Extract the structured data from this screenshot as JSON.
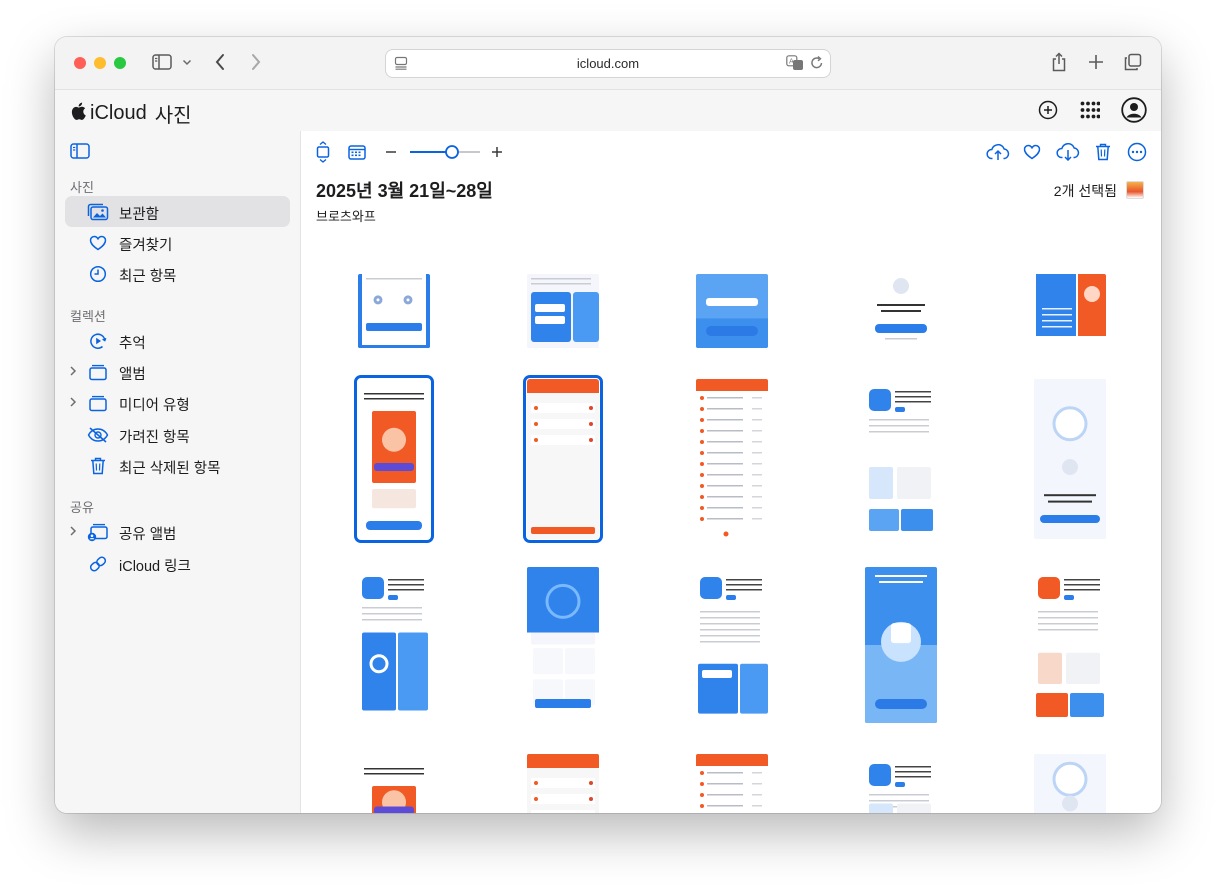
{
  "browser": {
    "url": "icloud.com"
  },
  "app": {
    "brand": "iCloud",
    "section": "사진"
  },
  "sidebar": {
    "sections": [
      {
        "title": "사진",
        "items": [
          {
            "label": "보관함",
            "icon": "photo-library-icon",
            "selected": true
          },
          {
            "label": "즐겨찾기",
            "icon": "heart-icon"
          },
          {
            "label": "최근 항목",
            "icon": "clock-icon"
          }
        ]
      },
      {
        "title": "컬렉션",
        "items": [
          {
            "label": "추억",
            "icon": "memories-icon"
          },
          {
            "label": "앨범",
            "icon": "album-icon",
            "expandable": true
          },
          {
            "label": "미디어 유형",
            "icon": "media-types-icon",
            "expandable": true
          },
          {
            "label": "가려진 항목",
            "icon": "eye-slash-icon"
          },
          {
            "label": "최근 삭제된 항목",
            "icon": "trash-icon"
          }
        ]
      },
      {
        "title": "공유",
        "items": [
          {
            "label": "공유 앨범",
            "icon": "shared-album-icon",
            "expandable": true
          },
          {
            "label": "iCloud 링크",
            "icon": "link-icon"
          }
        ]
      }
    ]
  },
  "main": {
    "title": "2025년 3월 21일~28일",
    "location": "브로츠와프",
    "selection_text": "2개 선택됨",
    "zoom_level": 0.6,
    "thumbnails": [
      {
        "row": 0,
        "col": 0,
        "theme": "blue-white",
        "selected": false
      },
      {
        "row": 0,
        "col": 1,
        "theme": "blue-cards",
        "selected": false
      },
      {
        "row": 0,
        "col": 2,
        "theme": "blue-gradient",
        "selected": false
      },
      {
        "row": 0,
        "col": 3,
        "theme": "white-robot",
        "selected": false
      },
      {
        "row": 0,
        "col": 4,
        "theme": "blue-orange",
        "selected": false
      },
      {
        "row": 1,
        "col": 0,
        "theme": "orange-cleaner",
        "selected": true
      },
      {
        "row": 1,
        "col": 1,
        "theme": "white-list-orange",
        "selected": true
      },
      {
        "row": 1,
        "col": 2,
        "theme": "orange-list",
        "selected": false
      },
      {
        "row": 1,
        "col": 3,
        "theme": "appstore-blue",
        "selected": false
      },
      {
        "row": 1,
        "col": 4,
        "theme": "robot-circle",
        "selected": false
      },
      {
        "row": 2,
        "col": 0,
        "theme": "appstore-phones",
        "selected": false
      },
      {
        "row": 2,
        "col": 1,
        "theme": "blue-percent",
        "selected": false
      },
      {
        "row": 2,
        "col": 2,
        "theme": "appstore-cards",
        "selected": false
      },
      {
        "row": 2,
        "col": 3,
        "theme": "blue-trophy",
        "selected": false
      },
      {
        "row": 2,
        "col": 4,
        "theme": "appstore-orange",
        "selected": false
      },
      {
        "row": 3,
        "col": 0,
        "theme": "orange-cleaner",
        "selected": false
      },
      {
        "row": 3,
        "col": 1,
        "theme": "white-list-orange",
        "selected": false
      },
      {
        "row": 3,
        "col": 2,
        "theme": "orange-list",
        "selected": false
      },
      {
        "row": 3,
        "col": 3,
        "theme": "appstore-blue",
        "selected": false
      },
      {
        "row": 3,
        "col": 4,
        "theme": "robot-circle",
        "selected": false
      }
    ]
  },
  "colors": {
    "accent": "#0a63e0",
    "orange": "#f15a24",
    "blue": "#2b7de9"
  }
}
